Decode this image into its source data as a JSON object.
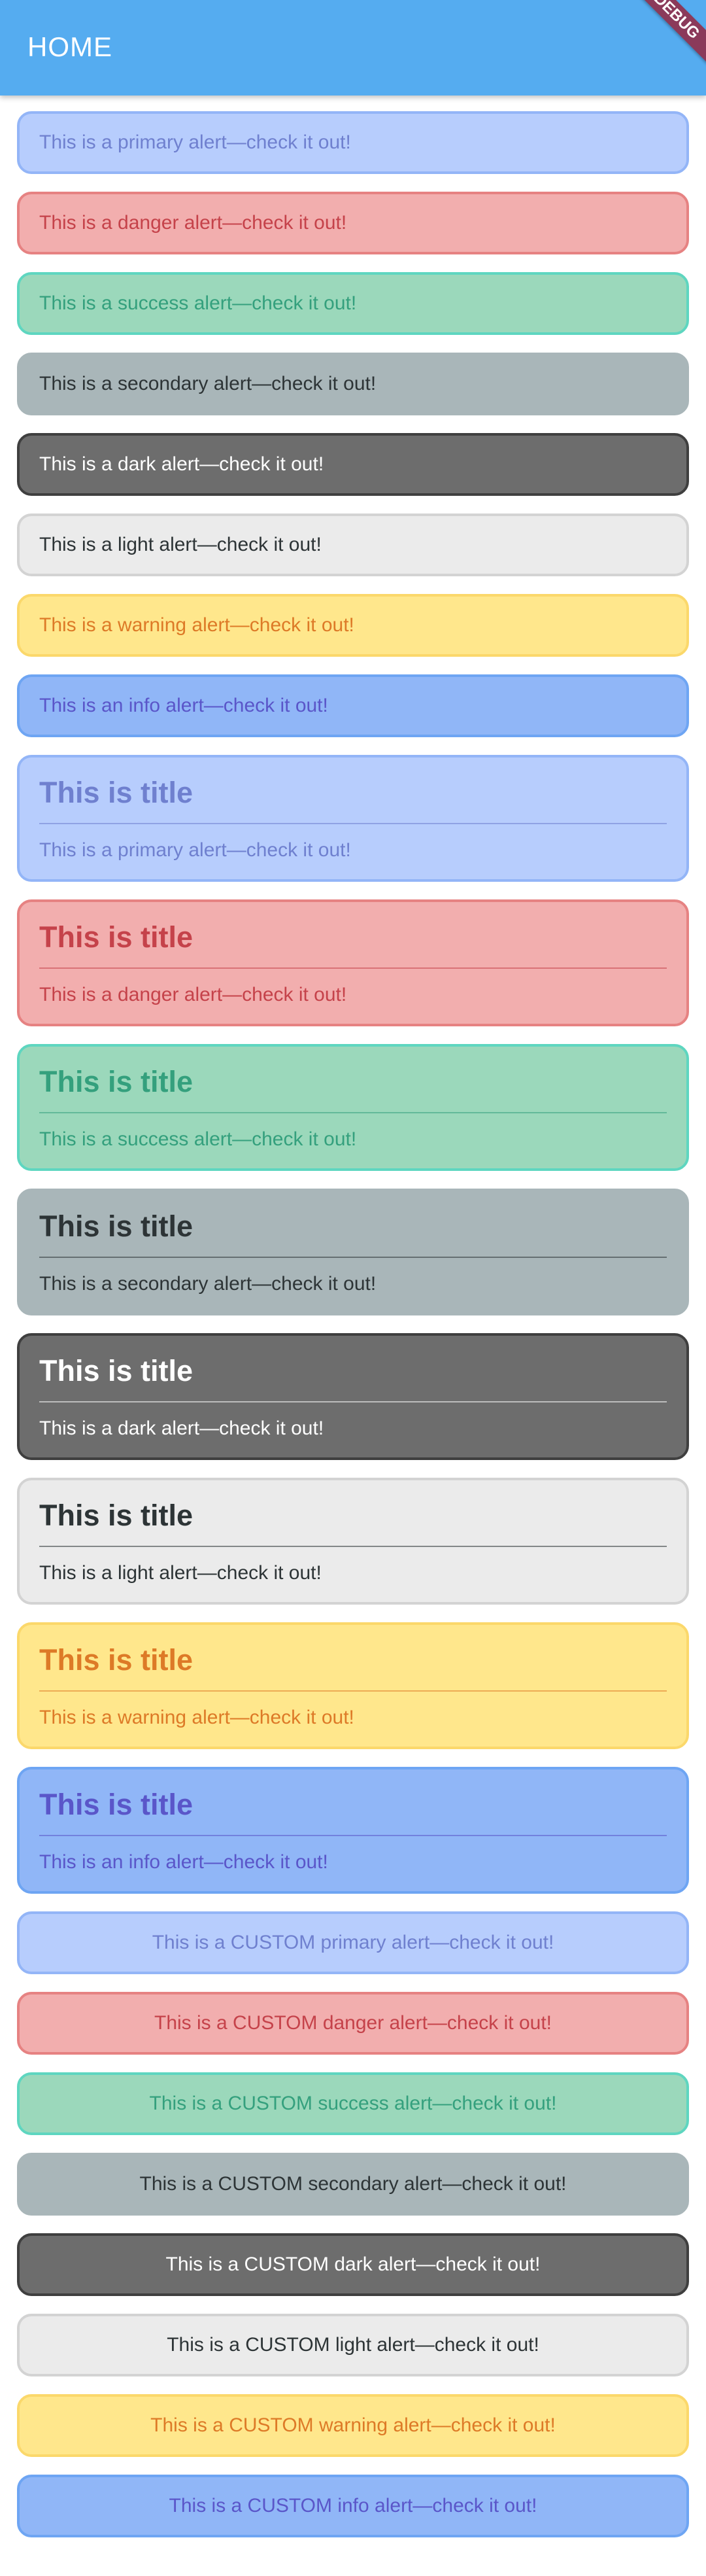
{
  "appbar": {
    "title": "HOME",
    "debug_label": "DEBUG"
  },
  "simple_alerts": [
    {
      "variant": "primary",
      "message": "This is a primary alert—check it out!"
    },
    {
      "variant": "danger",
      "message": "This is a danger alert—check it out!"
    },
    {
      "variant": "success",
      "message": "This is a success alert—check it out!"
    },
    {
      "variant": "secondary",
      "message": "This is a secondary alert—check it out!"
    },
    {
      "variant": "dark",
      "message": "This is a dark alert—check it out!"
    },
    {
      "variant": "light",
      "message": "This is a light alert—check it out!"
    },
    {
      "variant": "warning",
      "message": "This is a warning alert—check it out!"
    },
    {
      "variant": "info",
      "message": "This is an info alert—check it out!"
    }
  ],
  "titled_alerts": [
    {
      "variant": "primary",
      "title": "This is title",
      "message": "This is a primary alert—check it out!"
    },
    {
      "variant": "danger",
      "title": "This is title",
      "message": "This is a danger alert—check it out!"
    },
    {
      "variant": "success",
      "title": "This is title",
      "message": "This is a success alert—check it out!"
    },
    {
      "variant": "secondary",
      "title": "This is title",
      "message": "This is a secondary alert—check it out!"
    },
    {
      "variant": "dark",
      "title": "This is title",
      "message": "This is a dark alert—check it out!"
    },
    {
      "variant": "light",
      "title": "This is title",
      "message": "This is a light alert—check it out!"
    },
    {
      "variant": "warning",
      "title": "This is title",
      "message": "This is a warning alert—check it out!"
    },
    {
      "variant": "info",
      "title": "This is title",
      "message": "This is an info alert—check it out!"
    }
  ],
  "custom_alerts": [
    {
      "variant": "primary",
      "message": "This is a CUSTOM primary alert—check it out!"
    },
    {
      "variant": "danger",
      "message": "This is a CUSTOM danger alert—check it out!"
    },
    {
      "variant": "success",
      "message": "This is a CUSTOM success alert—check it out!"
    },
    {
      "variant": "secondary",
      "message": "This is a CUSTOM secondary alert—check it out!"
    },
    {
      "variant": "dark",
      "message": "This is a CUSTOM dark alert—check it out!"
    },
    {
      "variant": "light",
      "message": "This is a CUSTOM light alert—check it out!"
    },
    {
      "variant": "warning",
      "message": "This is a CUSTOM warning alert—check it out!"
    },
    {
      "variant": "info",
      "message": "This is a CUSTOM info alert—check it out!"
    }
  ],
  "colors": {
    "appbar": "#55acf0",
    "primary": "#b7cdfd",
    "danger": "#f2aeae",
    "success": "#9bd8bb",
    "secondary": "#a9b6b9",
    "dark": "#6d6d6d",
    "light": "#ebebeb",
    "warning": "#ffe78c",
    "info": "#90b6f7"
  }
}
